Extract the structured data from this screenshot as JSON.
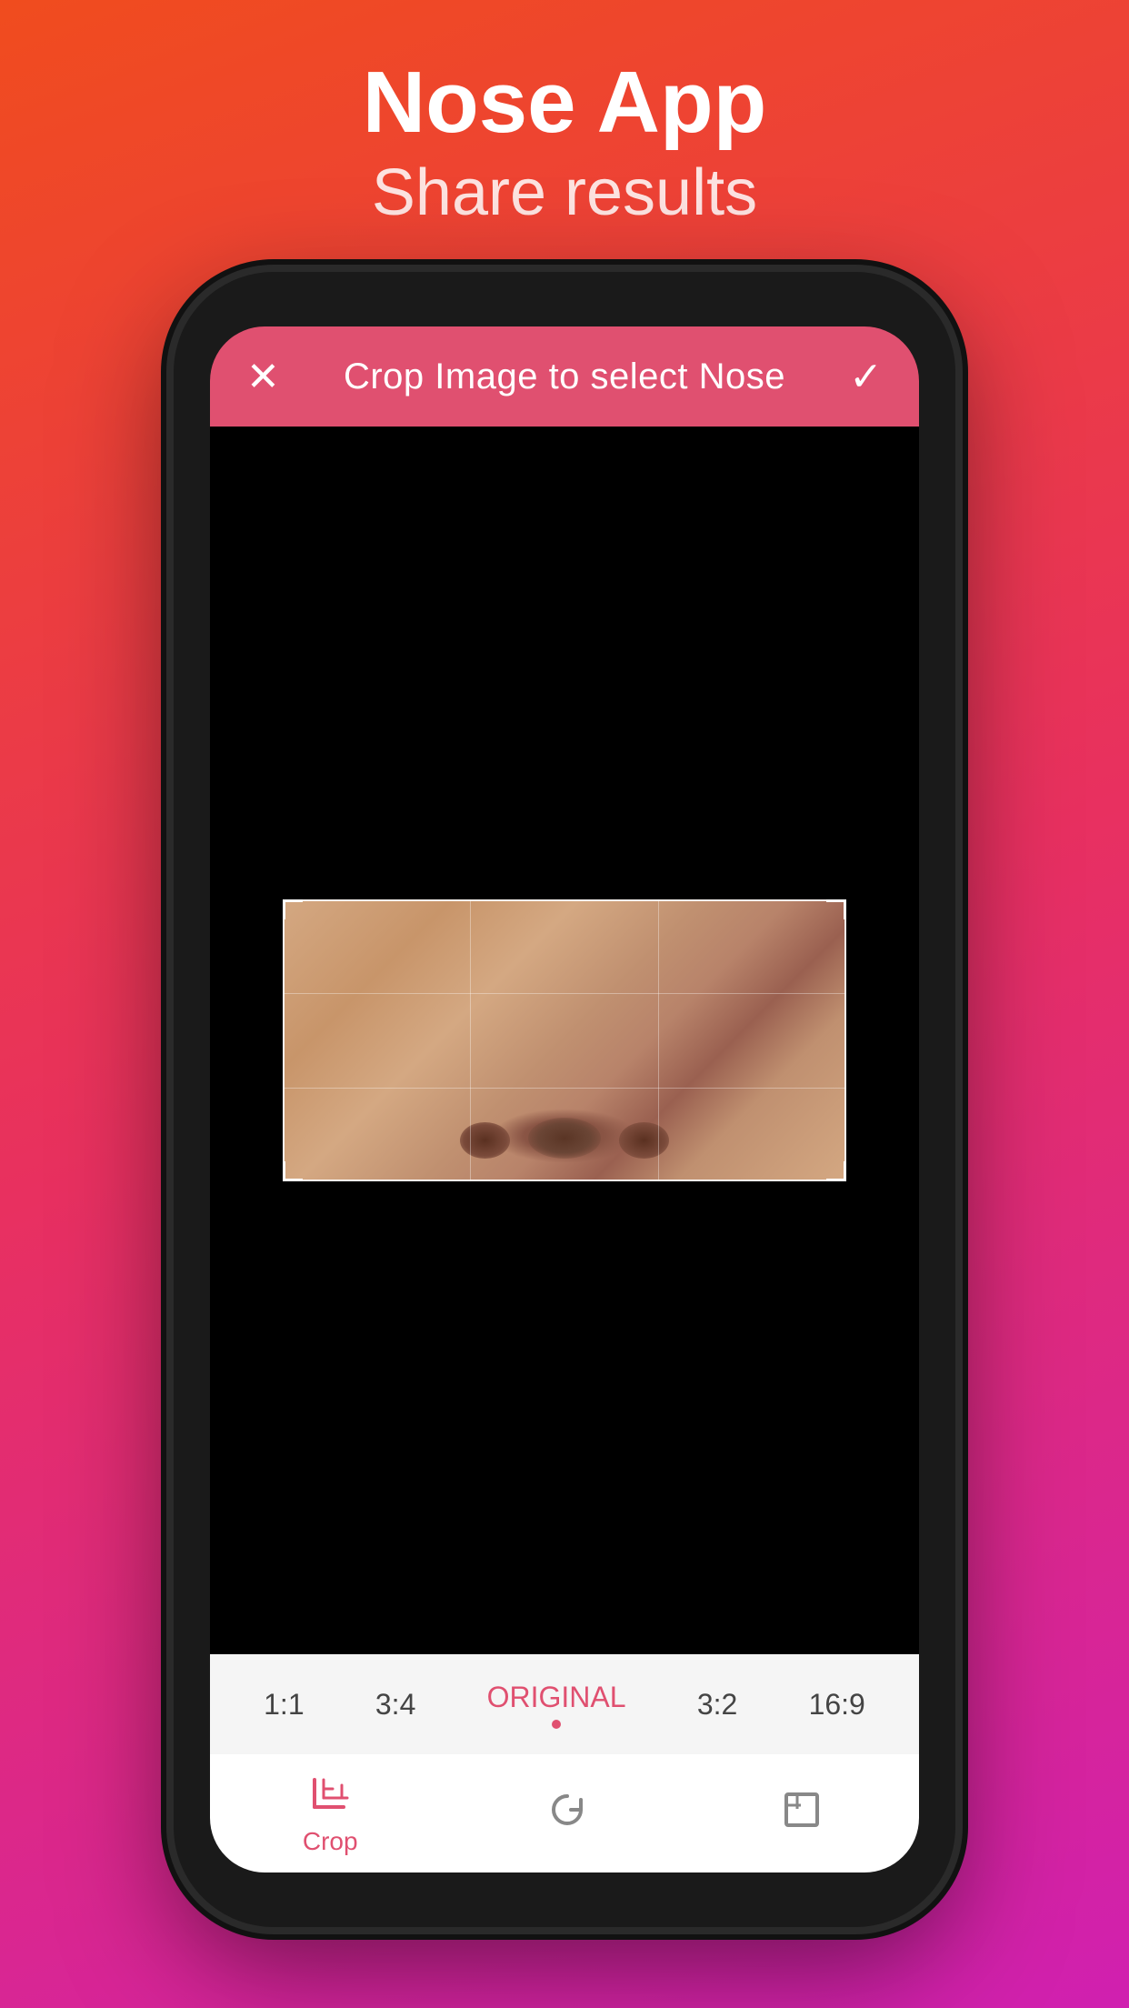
{
  "header": {
    "title": "Nose App",
    "subtitle": "Share results"
  },
  "toolbar": {
    "title": "Crop Image to select Nose",
    "close_icon": "✕",
    "confirm_icon": "✓"
  },
  "ratios": [
    {
      "label": "1:1",
      "active": false
    },
    {
      "label": "3:4",
      "active": false
    },
    {
      "label": "ORIGINAL",
      "active": true
    },
    {
      "label": "3:2",
      "active": false
    },
    {
      "label": "16:9",
      "active": false
    }
  ],
  "bottom_tools": [
    {
      "label": "Crop",
      "active": true
    },
    {
      "label": "",
      "active": false
    },
    {
      "label": "",
      "active": false
    }
  ],
  "colors": {
    "accent": "#e05070",
    "background_start": "#f04c1e",
    "background_end": "#d020b0"
  }
}
